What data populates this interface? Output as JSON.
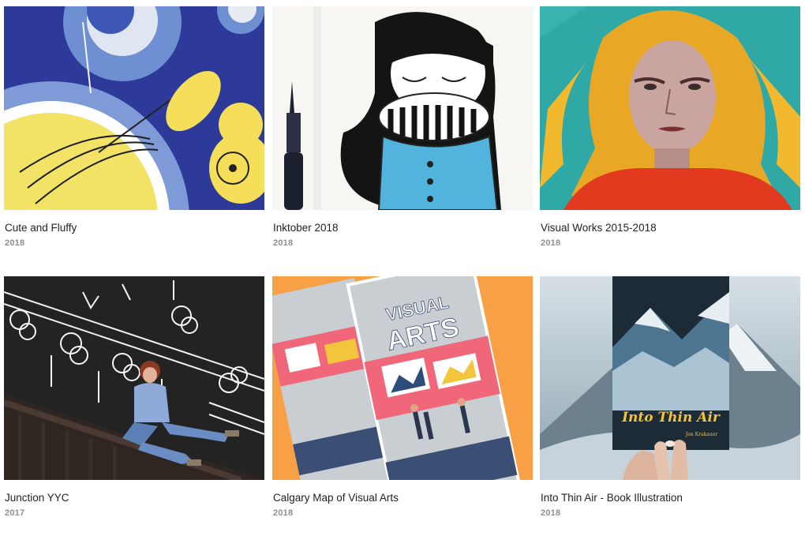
{
  "projects": [
    {
      "title": "Cute and Fluffy",
      "year": "2018"
    },
    {
      "title": "Inktober 2018",
      "year": "2018"
    },
    {
      "title": "Visual Works 2015-2018",
      "year": "2018"
    },
    {
      "title": "Junction YYC",
      "year": "2017"
    },
    {
      "title": "Calgary Map of Visual Arts",
      "year": "2018"
    },
    {
      "title": "Into Thin Air - Book Illustration",
      "year": "2018"
    }
  ],
  "artwork_text": {
    "visual_arts_line1": "VISUAL",
    "visual_arts_line2": "ARTS",
    "book_title": "Into Thin Air",
    "book_author": "Jon Krakauer"
  }
}
